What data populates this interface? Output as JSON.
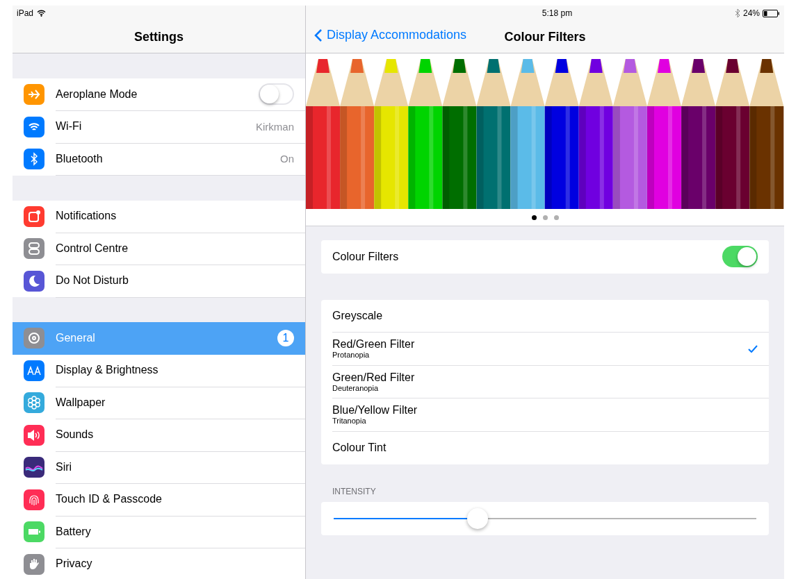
{
  "status_bar": {
    "device": "iPad",
    "time": "5:18 pm",
    "battery": "24%"
  },
  "sidebar": {
    "title": "Settings",
    "groups": [
      {
        "items": [
          {
            "kind": "airplane",
            "color": "#ff9500",
            "label": "Aeroplane Mode",
            "on": false,
            "selected": false
          },
          {
            "kind": "wifi",
            "color": "#007aff",
            "label": "Wi-Fi",
            "value": "Kirkman",
            "selected": false
          },
          {
            "kind": "bluetooth",
            "color": "#007aff",
            "label": "Bluetooth",
            "value": "On",
            "selected": false
          }
        ]
      },
      {
        "items": [
          {
            "kind": "notifications",
            "color": "#ff3b30",
            "label": "Notifications",
            "selected": false
          },
          {
            "kind": "switches",
            "color": "#8e8e93",
            "label": "Control Centre",
            "selected": false
          },
          {
            "kind": "moon",
            "color": "#5856d6",
            "label": "Do Not Disturb",
            "selected": false
          }
        ]
      },
      {
        "items": [
          {
            "kind": "gear",
            "color": "#8e8e93",
            "label": "General",
            "badge": "1",
            "selected": true
          },
          {
            "kind": "text",
            "color": "#007aff",
            "label": "Display & Brightness",
            "selected": false
          },
          {
            "kind": "flower",
            "color": "#34aadc",
            "label": "Wallpaper",
            "selected": false
          },
          {
            "kind": "speaker",
            "color": "#ff2d55",
            "label": "Sounds",
            "selected": false
          },
          {
            "kind": "waves",
            "color": "#3a2a7a",
            "label": "Siri",
            "selected": false
          },
          {
            "kind": "fingerprint",
            "color": "#ff2d55",
            "label": "Touch ID & Passcode",
            "selected": false
          },
          {
            "kind": "battery",
            "color": "#4cd964",
            "label": "Battery",
            "selected": false
          },
          {
            "kind": "hand",
            "color": "#8e8e93",
            "label": "Privacy",
            "selected": false
          }
        ]
      }
    ]
  },
  "detail": {
    "back": "Display Accommodations",
    "title": "Colour Filters",
    "page_dots": [
      {
        "selected": true
      },
      {
        "selected": false
      },
      {
        "selected": false
      }
    ],
    "toggle": {
      "label": "Colour Filters",
      "on": true
    },
    "filters": [
      {
        "label": "Greyscale",
        "selected": false
      },
      {
        "label": "Red/Green Filter",
        "subtitle": "Protanopia",
        "selected": true
      },
      {
        "label": "Green/Red Filter",
        "subtitle": "Deuteranopia",
        "selected": false
      },
      {
        "label": "Blue/Yellow Filter",
        "subtitle": "Tritanopia",
        "selected": false
      },
      {
        "label": "Colour Tint",
        "selected": false
      }
    ],
    "intensity": {
      "label": "INTENSITY",
      "level": 0.34
    }
  }
}
